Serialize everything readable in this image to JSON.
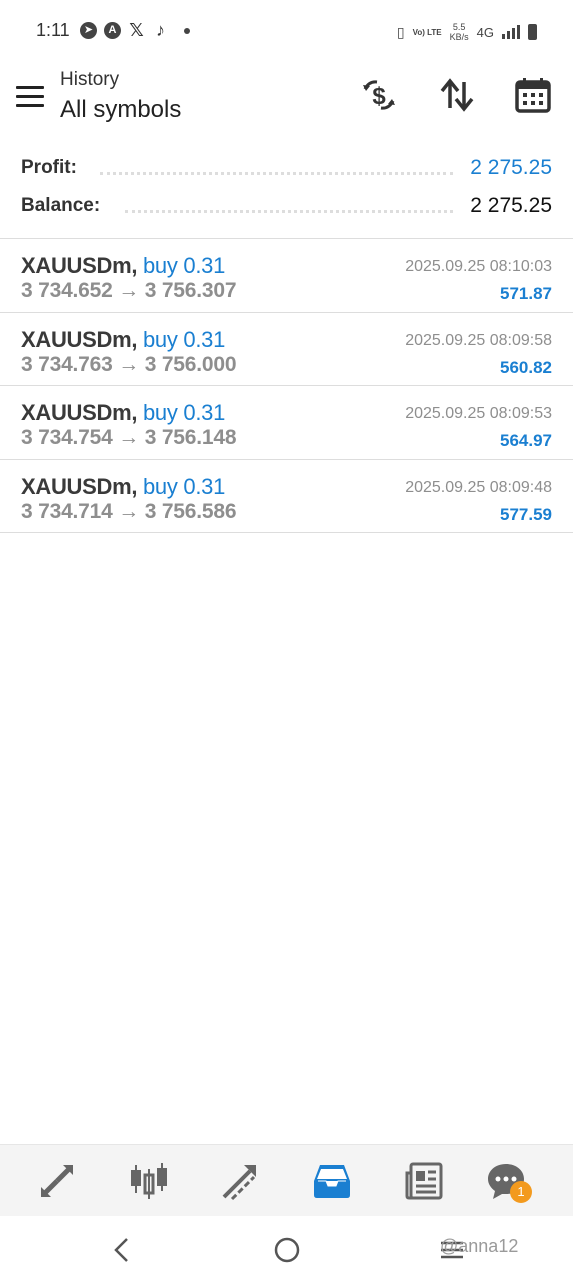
{
  "status_bar": {
    "time": "1:11",
    "volte": "Vo) LTE",
    "speed_value": "5.5",
    "speed_unit": "KB/s",
    "network": "4G"
  },
  "header": {
    "subtitle": "History",
    "title": "All symbols",
    "icons": [
      "menu-icon",
      "currency-exchange-icon",
      "sort-icon",
      "calendar-icon"
    ]
  },
  "summary": {
    "profit_label": "Profit:",
    "profit_value": "2 275.25",
    "balance_label": "Balance:",
    "balance_value": "2 275.25"
  },
  "trades": [
    {
      "symbol": "XAUUSDm,",
      "side": "buy 0.31",
      "open": "3 734.652",
      "arrow": "→",
      "close": "3 756.307",
      "time": "2025.09.25 08:10:03",
      "profit": "571.87"
    },
    {
      "symbol": "XAUUSDm,",
      "side": "buy 0.31",
      "open": "3 734.763",
      "arrow": "→",
      "close": "3 756.000",
      "time": "2025.09.25 08:09:58",
      "profit": "560.82"
    },
    {
      "symbol": "XAUUSDm,",
      "side": "buy 0.31",
      "open": "3 734.754",
      "arrow": "→",
      "close": "3 756.148",
      "time": "2025.09.25 08:09:53",
      "profit": "564.97"
    },
    {
      "symbol": "XAUUSDm,",
      "side": "buy 0.31",
      "open": "3 734.714",
      "arrow": "→",
      "close": "3 756.586",
      "time": "2025.09.25 08:09:48",
      "profit": "577.59"
    }
  ],
  "bottom_nav": {
    "items": [
      "quotes-icon",
      "chart-icon",
      "trade-icon",
      "history-icon",
      "news-icon",
      "messages-icon"
    ],
    "active": "history-icon",
    "messages_badge": "1"
  },
  "colors": {
    "accent": "#1a7fd1",
    "badge": "#f39a1e"
  },
  "watermark": "@anna12"
}
